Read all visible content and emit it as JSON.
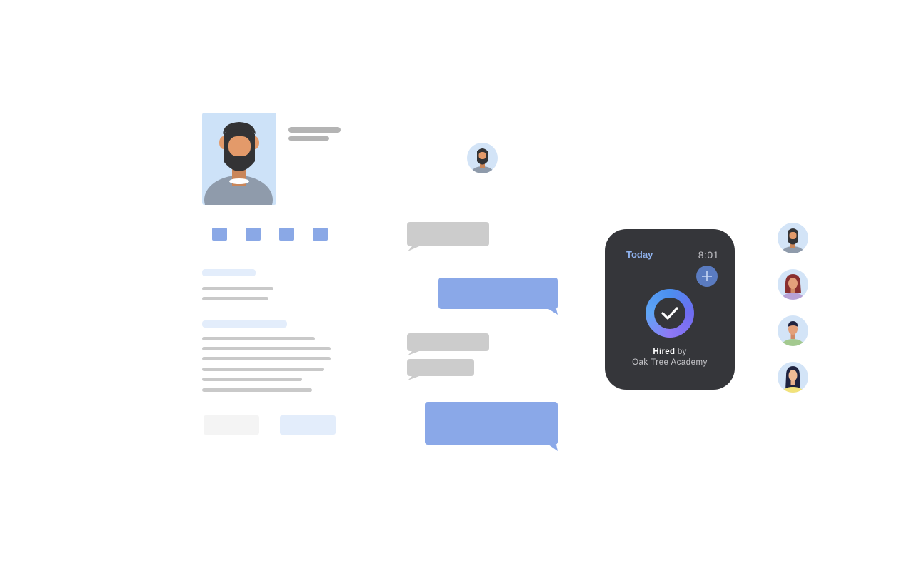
{
  "watch": {
    "today_label": "Today",
    "time": "8:01",
    "hired_label": "Hired",
    "by_label": "by",
    "company": "Oak Tree Academy"
  },
  "icons": [
    "avatar-bearded-man",
    "plus-icon",
    "checkmark-icon"
  ],
  "colors": {
    "accent_blue": "#8aa8e8",
    "watch_bg": "#35363a",
    "photo_bg": "#cde2f8"
  }
}
